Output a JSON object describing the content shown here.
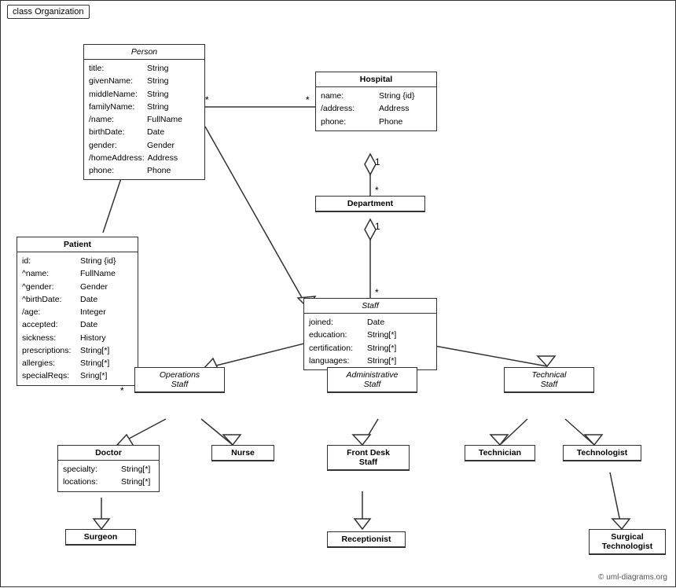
{
  "diagram": {
    "title": "class Organization",
    "copyright": "© uml-diagrams.org",
    "classes": {
      "person": {
        "name": "Person",
        "italic": true,
        "attrs": [
          {
            "name": "title:",
            "type": "String"
          },
          {
            "name": "givenName:",
            "type": "String"
          },
          {
            "name": "middleName:",
            "type": "String"
          },
          {
            "name": "familyName:",
            "type": "String"
          },
          {
            "name": "/name:",
            "type": "FullName"
          },
          {
            "name": "birthDate:",
            "type": "Date"
          },
          {
            "name": "gender:",
            "type": "Gender"
          },
          {
            "name": "/homeAddress:",
            "type": "Address"
          },
          {
            "name": "phone:",
            "type": "Phone"
          }
        ]
      },
      "hospital": {
        "name": "Hospital",
        "italic": false,
        "attrs": [
          {
            "name": "name:",
            "type": "String {id}"
          },
          {
            "name": "/address:",
            "type": "Address"
          },
          {
            "name": "phone:",
            "type": "Phone"
          }
        ]
      },
      "patient": {
        "name": "Patient",
        "italic": false,
        "attrs": [
          {
            "name": "id:",
            "type": "String {id}"
          },
          {
            "name": "^name:",
            "type": "FullName"
          },
          {
            "name": "^gender:",
            "type": "Gender"
          },
          {
            "name": "^birthDate:",
            "type": "Date"
          },
          {
            "name": "/age:",
            "type": "Integer"
          },
          {
            "name": "accepted:",
            "type": "Date"
          },
          {
            "name": "sickness:",
            "type": "History"
          },
          {
            "name": "prescriptions:",
            "type": "String[*]"
          },
          {
            "name": "allergies:",
            "type": "String[*]"
          },
          {
            "name": "specialReqs:",
            "type": "Sring[*]"
          }
        ]
      },
      "department": {
        "name": "Department",
        "italic": false,
        "attrs": []
      },
      "staff": {
        "name": "Staff",
        "italic": true,
        "attrs": [
          {
            "name": "joined:",
            "type": "Date"
          },
          {
            "name": "education:",
            "type": "String[*]"
          },
          {
            "name": "certification:",
            "type": "String[*]"
          },
          {
            "name": "languages:",
            "type": "String[*]"
          }
        ]
      },
      "operations_staff": {
        "name": "Operations Staff",
        "italic": true,
        "attrs": []
      },
      "administrative_staff": {
        "name": "Administrative Staff",
        "italic": true,
        "attrs": []
      },
      "technical_staff": {
        "name": "Technical Staff",
        "italic": true,
        "attrs": []
      },
      "doctor": {
        "name": "Doctor",
        "italic": false,
        "attrs": [
          {
            "name": "specialty:",
            "type": "String[*]"
          },
          {
            "name": "locations:",
            "type": "String[*]"
          }
        ]
      },
      "nurse": {
        "name": "Nurse",
        "italic": false,
        "attrs": []
      },
      "front_desk_staff": {
        "name": "Front Desk Staff",
        "italic": false,
        "attrs": []
      },
      "technician": {
        "name": "Technician",
        "italic": false,
        "attrs": []
      },
      "technologist": {
        "name": "Technologist",
        "italic": false,
        "attrs": []
      },
      "surgeon": {
        "name": "Surgeon",
        "italic": false,
        "attrs": []
      },
      "receptionist": {
        "name": "Receptionist",
        "italic": false,
        "attrs": []
      },
      "surgical_technologist": {
        "name": "Surgical Technologist",
        "italic": false,
        "attrs": []
      }
    }
  }
}
